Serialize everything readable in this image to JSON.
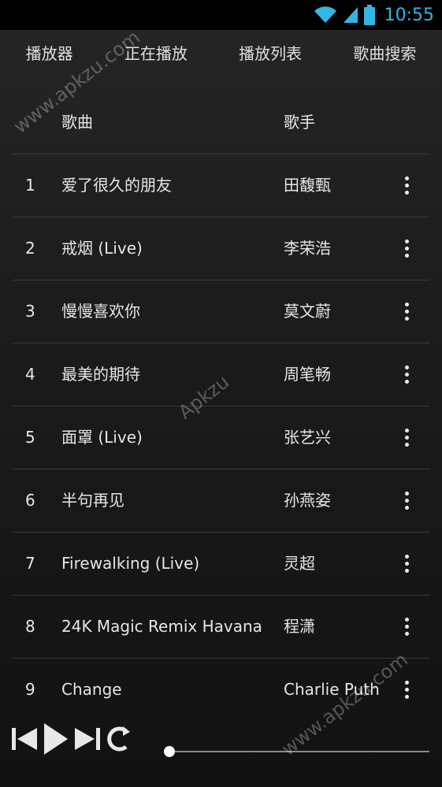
{
  "status": {
    "time": "10:55"
  },
  "tabs": [
    {
      "label": "播放器"
    },
    {
      "label": "正在播放"
    },
    {
      "label": "播放列表"
    },
    {
      "label": "歌曲搜索"
    }
  ],
  "table": {
    "headers": {
      "title": "歌曲",
      "artist": "歌手"
    },
    "rows": [
      {
        "index": "1",
        "title": "爱了很久的朋友",
        "artist": "田馥甄"
      },
      {
        "index": "2",
        "title": "戒烟 (Live)",
        "artist": "李荣浩"
      },
      {
        "index": "3",
        "title": "慢慢喜欢你",
        "artist": "莫文蔚"
      },
      {
        "index": "4",
        "title": "最美的期待",
        "artist": "周笔畅"
      },
      {
        "index": "5",
        "title": "面罩 (Live)",
        "artist": "张艺兴"
      },
      {
        "index": "6",
        "title": "半句再见",
        "artist": "孙燕姿"
      },
      {
        "index": "7",
        "title": "Firewalking (Live)",
        "artist": "灵超"
      },
      {
        "index": "8",
        "title": "24K Magic Remix Havana",
        "artist": "程潇"
      },
      {
        "index": "9",
        "title": "Change",
        "artist": "Charlie Puth"
      }
    ]
  },
  "player": {
    "progress": 0
  },
  "watermarks": {
    "top": "www.apkzu.com",
    "middle": "Apkzu",
    "bottom": "www.apkzu.com"
  },
  "colors": {
    "accent": "#33b5e5",
    "background": "#1c1c1c"
  },
  "icons": [
    "wifi-icon",
    "signal-icon",
    "battery-icon",
    "previous-icon",
    "play-icon",
    "next-icon",
    "repeat-icon",
    "more-vert-icon"
  ]
}
